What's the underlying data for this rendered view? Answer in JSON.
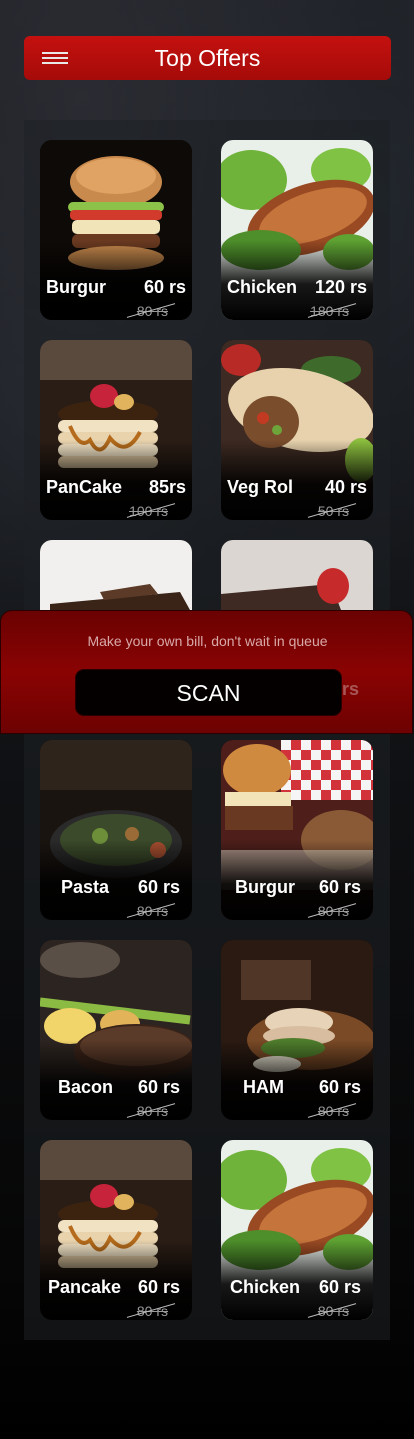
{
  "header": {
    "title": "Top Offers",
    "menu_icon": "hamburger-menu-icon"
  },
  "colors": {
    "accent_red": "#b80d0b",
    "modal_red": "#7d0303",
    "card_bg": "#000000"
  },
  "offers": [
    {
      "name": "Burgur",
      "price": "60 rs",
      "old_price": "80 rs"
    },
    {
      "name": "Chicken",
      "price": "120 rs",
      "old_price": "180 rs"
    },
    {
      "name": "PanCake",
      "price": "85rs",
      "old_price": "100 rs"
    },
    {
      "name": "Veg Rol",
      "price": "40 rs",
      "old_price": "50 rs"
    },
    {
      "name": "",
      "price": "",
      "old_price": ""
    },
    {
      "name": "",
      "price": "",
      "old_price": ""
    },
    {
      "name": "Pasta",
      "price": "60 rs",
      "old_price": "80 rs"
    },
    {
      "name": "Burgur",
      "price": "60 rs",
      "old_price": "80 rs"
    },
    {
      "name": "Bacon",
      "price": "60 rs",
      "old_price": "80 rs"
    },
    {
      "name": "HAM",
      "price": "60 rs",
      "old_price": "80 rs"
    },
    {
      "name": "Pancake",
      "price": "60 rs",
      "old_price": "80 rs"
    },
    {
      "name": "Chicken",
      "price": "60 rs",
      "old_price": "80 rs"
    }
  ],
  "hidden_card_price": "rs",
  "scan_modal": {
    "message": "Make your own bill, don't wait in queue",
    "button_label": "SCAN"
  }
}
